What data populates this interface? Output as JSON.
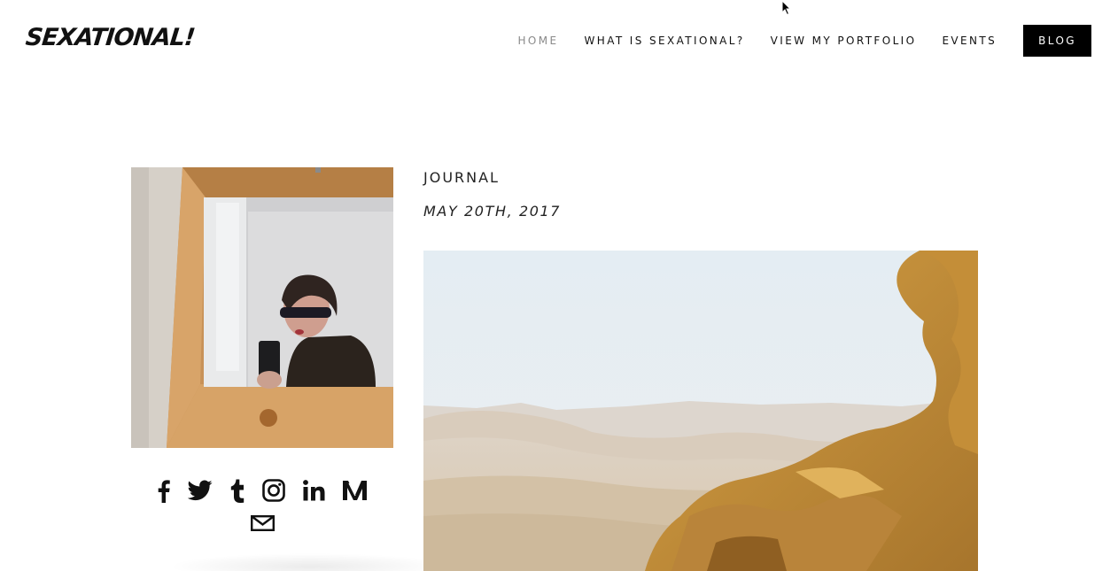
{
  "site": {
    "logo_text": "SEXATIONAL!"
  },
  "nav": {
    "items": [
      {
        "label": "HOME",
        "active": true
      },
      {
        "label": "WHAT IS SEXATIONAL?",
        "active": false
      },
      {
        "label": "VIEW MY PORTFOLIO",
        "active": false
      },
      {
        "label": "EVENTS",
        "active": false
      },
      {
        "label": "BLOG",
        "active": false,
        "highlighted": true
      }
    ]
  },
  "sidebar": {
    "social_icons": [
      "facebook-icon",
      "twitter-icon",
      "tumblr-icon",
      "instagram-icon",
      "linkedin-icon",
      "medium-icon",
      "email-icon"
    ]
  },
  "post": {
    "category": "JOURNAL",
    "date": "MAY 20TH, 2017"
  },
  "colors": {
    "text": "#111111",
    "nav_active": "#8a8a8a",
    "blog_button_bg": "#000000",
    "blog_button_text": "#ffffff",
    "background": "#ffffff"
  }
}
